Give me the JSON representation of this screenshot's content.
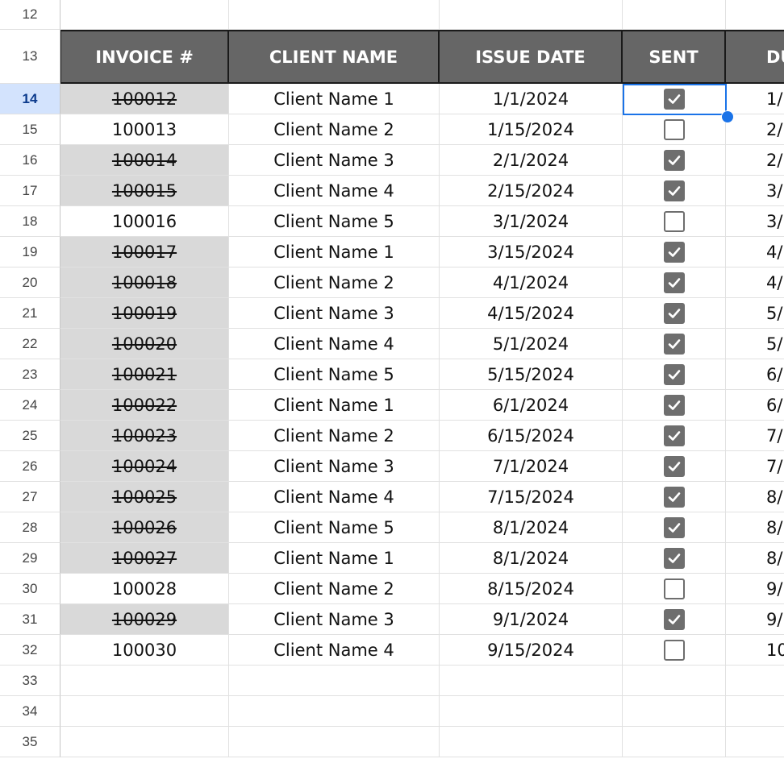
{
  "sheet": {
    "headers": {
      "invoice": "INVOICE #",
      "client": "CLIENT NAME",
      "issue_date": "ISSUE DATE",
      "sent": "SENT",
      "due": "DU"
    },
    "header_row_number": "13",
    "top_row_number": "12",
    "active_row": "14",
    "rows": [
      {
        "num": "14",
        "invoice": "100012",
        "client": "Client Name 1",
        "date": "1/1/2024",
        "sent": true,
        "due": "1/"
      },
      {
        "num": "15",
        "invoice": "100013",
        "client": "Client Name 2",
        "date": "1/15/2024",
        "sent": false,
        "due": "2/"
      },
      {
        "num": "16",
        "invoice": "100014",
        "client": "Client Name 3",
        "date": "2/1/2024",
        "sent": true,
        "due": "2/"
      },
      {
        "num": "17",
        "invoice": "100015",
        "client": "Client Name 4",
        "date": "2/15/2024",
        "sent": true,
        "due": "3/"
      },
      {
        "num": "18",
        "invoice": "100016",
        "client": "Client Name 5",
        "date": "3/1/2024",
        "sent": false,
        "due": "3/"
      },
      {
        "num": "19",
        "invoice": "100017",
        "client": "Client Name 1",
        "date": "3/15/2024",
        "sent": true,
        "due": "4/"
      },
      {
        "num": "20",
        "invoice": "100018",
        "client": "Client Name 2",
        "date": "4/1/2024",
        "sent": true,
        "due": "4/"
      },
      {
        "num": "21",
        "invoice": "100019",
        "client": "Client Name 3",
        "date": "4/15/2024",
        "sent": true,
        "due": "5/"
      },
      {
        "num": "22",
        "invoice": "100020",
        "client": "Client Name 4",
        "date": "5/1/2024",
        "sent": true,
        "due": "5/"
      },
      {
        "num": "23",
        "invoice": "100021",
        "client": "Client Name 5",
        "date": "5/15/2024",
        "sent": true,
        "due": "6/"
      },
      {
        "num": "24",
        "invoice": "100022",
        "client": "Client Name 1",
        "date": "6/1/2024",
        "sent": true,
        "due": "6/"
      },
      {
        "num": "25",
        "invoice": "100023",
        "client": "Client Name 2",
        "date": "6/15/2024",
        "sent": true,
        "due": "7/"
      },
      {
        "num": "26",
        "invoice": "100024",
        "client": "Client Name 3",
        "date": "7/1/2024",
        "sent": true,
        "due": "7/"
      },
      {
        "num": "27",
        "invoice": "100025",
        "client": "Client Name 4",
        "date": "7/15/2024",
        "sent": true,
        "due": "8/"
      },
      {
        "num": "28",
        "invoice": "100026",
        "client": "Client Name 5",
        "date": "8/1/2024",
        "sent": true,
        "due": "8/"
      },
      {
        "num": "29",
        "invoice": "100027",
        "client": "Client Name 1",
        "date": "8/1/2024",
        "sent": true,
        "due": "8/"
      },
      {
        "num": "30",
        "invoice": "100028",
        "client": "Client Name 2",
        "date": "8/15/2024",
        "sent": false,
        "due": "9/"
      },
      {
        "num": "31",
        "invoice": "100029",
        "client": "Client Name 3",
        "date": "9/1/2024",
        "sent": true,
        "due": "9/"
      },
      {
        "num": "32",
        "invoice": "100030",
        "client": "Client Name 4",
        "date": "9/15/2024",
        "sent": false,
        "due": "10"
      }
    ],
    "empty_rows": [
      "33",
      "34",
      "35"
    ],
    "colors": {
      "header_bg": "#666666",
      "paid_bg": "#d9d9d9",
      "checkbox": "#6e6e6e",
      "selection": "#1a73e8",
      "active_row_bg": "#d3e3fd"
    }
  }
}
